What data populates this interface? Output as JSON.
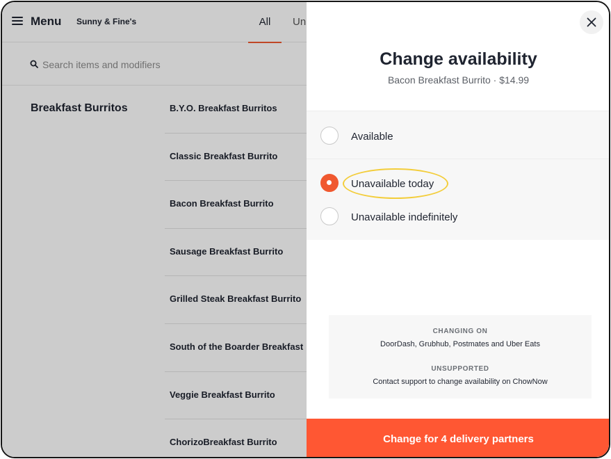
{
  "topbar": {
    "menu_label": "Menu",
    "store_name": "Sunny & Fine's",
    "tab_all": "All",
    "tab_unavailable": "Un"
  },
  "search": {
    "placeholder": "Search items and modifiers"
  },
  "menu": {
    "category": "Breakfast Burritos",
    "items": [
      "B.Y.O. Breakfast Burritos",
      "Classic Breakfast Burrito",
      "Bacon Breakfast Burrito",
      "Sausage Breakfast Burrito",
      "Grilled Steak Breakfast Burrito",
      "South of the Boarder Breakfast",
      "Veggie Breakfast Burrito",
      "ChorizoBreakfast Burrito"
    ]
  },
  "panel": {
    "title": "Change availability",
    "subtitle": "Bacon Breakfast Burrito · $14.99",
    "options": [
      {
        "label": "Available",
        "selected": false
      },
      {
        "label": "Unavailable today",
        "selected": true
      },
      {
        "label": "Unavailable indefinitely",
        "selected": false
      }
    ],
    "changing_on_heading": "CHANGING ON",
    "changing_on_text": "DoorDash, Grubhub, Postmates  and Uber Eats",
    "unsupported_heading": "UNSUPPORTED",
    "unsupported_text": "Contact support to change availability on ChowNow",
    "cta_label": "Change for 4 delivery partners"
  },
  "colors": {
    "accent": "#ff5733",
    "highlight": "#f3cd3a",
    "text": "#1f2430"
  }
}
